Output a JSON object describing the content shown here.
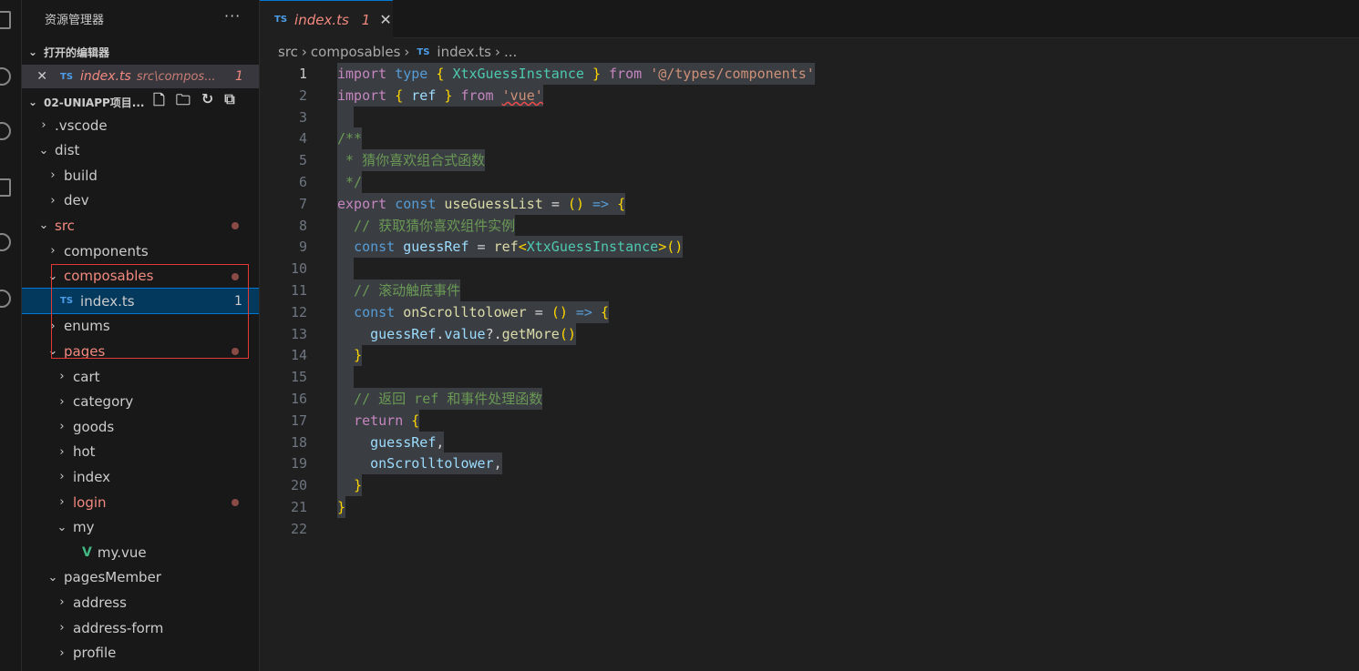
{
  "sidebar": {
    "title": "资源管理器",
    "more": "···",
    "open_editors_label": "打开的编辑器",
    "open_editor": {
      "close": "✕",
      "badge": "TS",
      "name": "index.ts",
      "path": "src\\compos...",
      "count": "1"
    },
    "project_label": "02-UNIAPP项目...",
    "tree": [
      {
        "label": ".vscode",
        "chev": "›",
        "red": false,
        "dot": false
      },
      {
        "label": "dist",
        "chev": "⌄",
        "red": false,
        "dot": false
      },
      {
        "label": "build",
        "chev": "›",
        "red": false,
        "dot": false
      },
      {
        "label": "dev",
        "chev": "›",
        "red": false,
        "dot": false
      },
      {
        "label": "src",
        "chev": "⌄",
        "red": true,
        "dot": true
      },
      {
        "label": "components",
        "chev": "›",
        "red": false,
        "dot": false
      },
      {
        "label": "composables",
        "chev": "⌄",
        "red": true,
        "dot": true
      },
      {
        "label": "index.ts",
        "chev": "",
        "badge": "TS",
        "red": false,
        "dot": false,
        "count": "1",
        "selected": true
      },
      {
        "label": "enums",
        "chev": "›",
        "red": false,
        "dot": false
      },
      {
        "label": "pages",
        "chev": "⌄",
        "red": true,
        "dot": true
      },
      {
        "label": "cart",
        "chev": "›",
        "red": false,
        "dot": false
      },
      {
        "label": "category",
        "chev": "›",
        "red": false,
        "dot": false
      },
      {
        "label": "goods",
        "chev": "›",
        "red": false,
        "dot": false
      },
      {
        "label": "hot",
        "chev": "›",
        "red": false,
        "dot": false
      },
      {
        "label": "index",
        "chev": "›",
        "red": false,
        "dot": false
      },
      {
        "label": "login",
        "chev": "›",
        "red": true,
        "dot": true
      },
      {
        "label": "my",
        "chev": "⌄",
        "red": false,
        "dot": false
      },
      {
        "label": "my.vue",
        "chev": "",
        "vue": true,
        "red": false,
        "dot": false
      },
      {
        "label": "pagesMember",
        "chev": "⌄",
        "red": false,
        "dot": false
      },
      {
        "label": "address",
        "chev": "›",
        "red": false,
        "dot": false
      },
      {
        "label": "address-form",
        "chev": "›",
        "red": false,
        "dot": false
      },
      {
        "label": "profile",
        "chev": "›",
        "red": false,
        "dot": false
      }
    ]
  },
  "editor": {
    "tab": {
      "badge": "TS",
      "name": "index.ts",
      "count": "1",
      "close": "✕"
    },
    "breadcrumb": [
      "src",
      "composables",
      "index.ts",
      "..."
    ],
    "lines": [
      "import type { XtxGuessInstance } from '@/types/components'",
      "import { ref } from 'vue'",
      "",
      "/**",
      " * 猜你喜欢组合式函数",
      " */",
      "export const useGuessList = () => {",
      "  // 获取猜你喜欢组件实例",
      "  const guessRef = ref<XtxGuessInstance>()",
      "",
      "  // 滚动触底事件",
      "  const onScrolltolower = () => {",
      "    guessRef.value?.getMore()",
      "  }",
      "",
      "  // 返回 ref 和事件处理函数",
      "  return {",
      "    guessRef,",
      "    onScrolltolower,",
      "  }",
      "}",
      ""
    ],
    "line_numbers": [
      "1",
      "2",
      "3",
      "4",
      "5",
      "6",
      "7",
      "8",
      "9",
      "10",
      "11",
      "12",
      "13",
      "14",
      "15",
      "16",
      "17",
      "18",
      "19",
      "20",
      "21",
      "22"
    ]
  }
}
